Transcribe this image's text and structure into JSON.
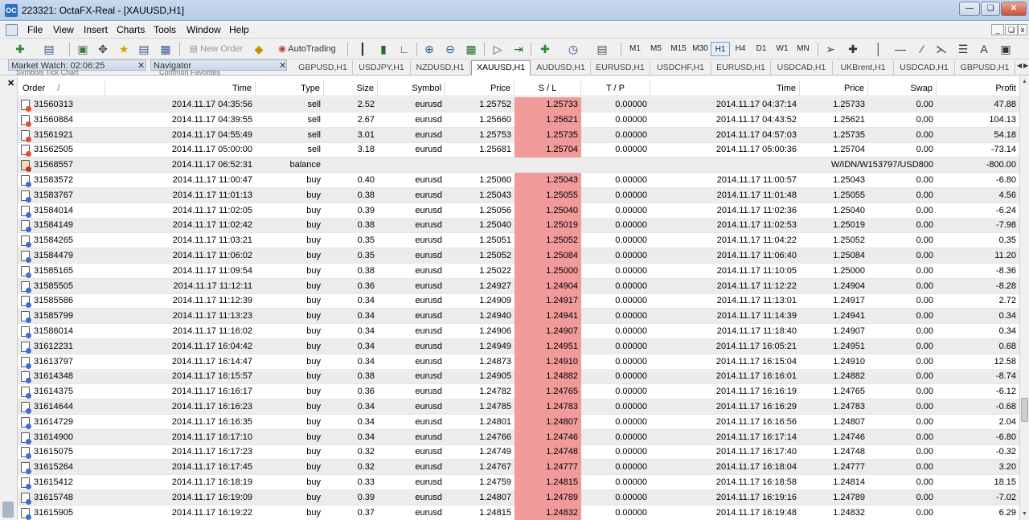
{
  "window": {
    "title": "223321: OctaFX-Real - [XAUUSD,H1]",
    "app_icon_text": "OC",
    "buttons": [
      "minimize",
      "restore",
      "close"
    ]
  },
  "menu": [
    "File",
    "View",
    "Insert",
    "Charts",
    "Tools",
    "Window",
    "Help"
  ],
  "toolbar": {
    "new_order_label": "New Order",
    "autotrading_label": "AutoTrading",
    "timeframes": [
      "M1",
      "M5",
      "M15",
      "M30",
      "H1",
      "H4",
      "D1",
      "W1",
      "MN"
    ],
    "active_timeframe": "H1",
    "draw_text_label": "A"
  },
  "market_watch": {
    "header": "Market Watch: 02:06:25",
    "tabs_ghost": "Symbols   Tick Chart"
  },
  "navigator": {
    "header": "Navigator",
    "tabs_ghost": "Common   Favorites"
  },
  "chart_tabs": [
    "GBPUSD,H1",
    "USDJPY,H1",
    "NZDUSD,H1",
    "XAUUSD,H1",
    "AUDUSD,H1",
    "EURUSD,H1",
    "USDCHF,H1",
    "EURUSD,H1",
    "USDCAD,H1",
    "UKBrent,H1",
    "USDCAD,H1",
    "GBPUSD,H1"
  ],
  "active_chart_tab": "XAUUSD,H1",
  "columns": {
    "order": "Order",
    "sort_marker": "/",
    "open_time": "Time",
    "type": "Type",
    "size": "Size",
    "symbol": "Symbol",
    "open_price": "Price",
    "sl": "S / L",
    "tp": "T / P",
    "close_time": "Time",
    "close_price": "Price",
    "swap": "Swap",
    "profit": "Profit"
  },
  "rows": [
    {
      "order": "31560313",
      "open_time": "2014.11.17 04:35:56",
      "type": "sell",
      "size": "2.52",
      "symbol": "eurusd",
      "open_price": "1.25752",
      "sl": "1.25733",
      "tp": "0.00000",
      "close_time": "2014.11.17 04:37:14",
      "close_price": "1.25733",
      "swap": "0.00",
      "profit": "47.88"
    },
    {
      "order": "31560884",
      "open_time": "2014.11.17 04:39:55",
      "type": "sell",
      "size": "2.67",
      "symbol": "eurusd",
      "open_price": "1.25660",
      "sl": "1.25621",
      "tp": "0.00000",
      "close_time": "2014.11.17 04:43:52",
      "close_price": "1.25621",
      "swap": "0.00",
      "profit": "104.13"
    },
    {
      "order": "31561921",
      "open_time": "2014.11.17 04:55:49",
      "type": "sell",
      "size": "3.01",
      "symbol": "eurusd",
      "open_price": "1.25753",
      "sl": "1.25735",
      "tp": "0.00000",
      "close_time": "2014.11.17 04:57:03",
      "close_price": "1.25735",
      "swap": "0.00",
      "profit": "54.18"
    },
    {
      "order": "31562505",
      "open_time": "2014.11.17 05:00:00",
      "type": "sell",
      "size": "3.18",
      "symbol": "eurusd",
      "open_price": "1.25681",
      "sl": "1.25704",
      "tp": "0.00000",
      "close_time": "2014.11.17 05:00:36",
      "close_price": "1.25704",
      "swap": "0.00",
      "profit": "-73.14"
    },
    {
      "order": "31568557",
      "open_time": "2014.11.17 06:52:31",
      "type": "balance",
      "size": "",
      "symbol": "",
      "open_price": "",
      "sl": "",
      "tp": "",
      "close_time": "",
      "close_price": "W/IDN/W153797/USD800",
      "swap": "",
      "profit": "-800.00"
    },
    {
      "order": "31583572",
      "open_time": "2014.11.17 11:00:47",
      "type": "buy",
      "size": "0.40",
      "symbol": "eurusd",
      "open_price": "1.25060",
      "sl": "1.25043",
      "tp": "0.00000",
      "close_time": "2014.11.17 11:00:57",
      "close_price": "1.25043",
      "swap": "0.00",
      "profit": "-6.80"
    },
    {
      "order": "31583767",
      "open_time": "2014.11.17 11:01:13",
      "type": "buy",
      "size": "0.38",
      "symbol": "eurusd",
      "open_price": "1.25043",
      "sl": "1.25055",
      "tp": "0.00000",
      "close_time": "2014.11.17 11:01:48",
      "close_price": "1.25055",
      "swap": "0.00",
      "profit": "4.56"
    },
    {
      "order": "31584014",
      "open_time": "2014.11.17 11:02:05",
      "type": "buy",
      "size": "0.39",
      "symbol": "eurusd",
      "open_price": "1.25056",
      "sl": "1.25040",
      "tp": "0.00000",
      "close_time": "2014.11.17 11:02:36",
      "close_price": "1.25040",
      "swap": "0.00",
      "profit": "-6.24"
    },
    {
      "order": "31584149",
      "open_time": "2014.11.17 11:02:42",
      "type": "buy",
      "size": "0.38",
      "symbol": "eurusd",
      "open_price": "1.25040",
      "sl": "1.25019",
      "tp": "0.00000",
      "close_time": "2014.11.17 11:02:53",
      "close_price": "1.25019",
      "swap": "0.00",
      "profit": "-7.98"
    },
    {
      "order": "31584265",
      "open_time": "2014.11.17 11:03:21",
      "type": "buy",
      "size": "0.35",
      "symbol": "eurusd",
      "open_price": "1.25051",
      "sl": "1.25052",
      "tp": "0.00000",
      "close_time": "2014.11.17 11:04:22",
      "close_price": "1.25052",
      "swap": "0.00",
      "profit": "0.35"
    },
    {
      "order": "31584479",
      "open_time": "2014.11.17 11:06:02",
      "type": "buy",
      "size": "0.35",
      "symbol": "eurusd",
      "open_price": "1.25052",
      "sl": "1.25084",
      "tp": "0.00000",
      "close_time": "2014.11.17 11:06:40",
      "close_price": "1.25084",
      "swap": "0.00",
      "profit": "11.20"
    },
    {
      "order": "31585165",
      "open_time": "2014.11.17 11:09:54",
      "type": "buy",
      "size": "0.38",
      "symbol": "eurusd",
      "open_price": "1.25022",
      "sl": "1.25000",
      "tp": "0.00000",
      "close_time": "2014.11.17 11:10:05",
      "close_price": "1.25000",
      "swap": "0.00",
      "profit": "-8.36"
    },
    {
      "order": "31585505",
      "open_time": "2014.11.17 11:12:11",
      "type": "buy",
      "size": "0.36",
      "symbol": "eurusd",
      "open_price": "1.24927",
      "sl": "1.24904",
      "tp": "0.00000",
      "close_time": "2014.11.17 11:12:22",
      "close_price": "1.24904",
      "swap": "0.00",
      "profit": "-8.28"
    },
    {
      "order": "31585586",
      "open_time": "2014.11.17 11:12:39",
      "type": "buy",
      "size": "0.34",
      "symbol": "eurusd",
      "open_price": "1.24909",
      "sl": "1.24917",
      "tp": "0.00000",
      "close_time": "2014.11.17 11:13:01",
      "close_price": "1.24917",
      "swap": "0.00",
      "profit": "2.72"
    },
    {
      "order": "31585799",
      "open_time": "2014.11.17 11:13:23",
      "type": "buy",
      "size": "0.34",
      "symbol": "eurusd",
      "open_price": "1.24940",
      "sl": "1.24941",
      "tp": "0.00000",
      "close_time": "2014.11.17 11:14:39",
      "close_price": "1.24941",
      "swap": "0.00",
      "profit": "0.34"
    },
    {
      "order": "31586014",
      "open_time": "2014.11.17 11:16:02",
      "type": "buy",
      "size": "0.34",
      "symbol": "eurusd",
      "open_price": "1.24906",
      "sl": "1.24907",
      "tp": "0.00000",
      "close_time": "2014.11.17 11:18:40",
      "close_price": "1.24907",
      "swap": "0.00",
      "profit": "0.34"
    },
    {
      "order": "31612231",
      "open_time": "2014.11.17 16:04:42",
      "type": "buy",
      "size": "0.34",
      "symbol": "eurusd",
      "open_price": "1.24949",
      "sl": "1.24951",
      "tp": "0.00000",
      "close_time": "2014.11.17 16:05:21",
      "close_price": "1.24951",
      "swap": "0.00",
      "profit": "0.68"
    },
    {
      "order": "31613797",
      "open_time": "2014.11.17 16:14:47",
      "type": "buy",
      "size": "0.34",
      "symbol": "eurusd",
      "open_price": "1.24873",
      "sl": "1.24910",
      "tp": "0.00000",
      "close_time": "2014.11.17 16:15:04",
      "close_price": "1.24910",
      "swap": "0.00",
      "profit": "12.58"
    },
    {
      "order": "31614348",
      "open_time": "2014.11.17 16:15:57",
      "type": "buy",
      "size": "0.38",
      "symbol": "eurusd",
      "open_price": "1.24905",
      "sl": "1.24882",
      "tp": "0.00000",
      "close_time": "2014.11.17 16:16:01",
      "close_price": "1.24882",
      "swap": "0.00",
      "profit": "-8.74"
    },
    {
      "order": "31614375",
      "open_time": "2014.11.17 16:16:17",
      "type": "buy",
      "size": "0.36",
      "symbol": "eurusd",
      "open_price": "1.24782",
      "sl": "1.24765",
      "tp": "0.00000",
      "close_time": "2014.11.17 16:16:19",
      "close_price": "1.24765",
      "swap": "0.00",
      "profit": "-6.12"
    },
    {
      "order": "31614644",
      "open_time": "2014.11.17 16:16:23",
      "type": "buy",
      "size": "0.34",
      "symbol": "eurusd",
      "open_price": "1.24785",
      "sl": "1.24783",
      "tp": "0.00000",
      "close_time": "2014.11.17 16:16:29",
      "close_price": "1.24783",
      "swap": "0.00",
      "profit": "-0.68"
    },
    {
      "order": "31614729",
      "open_time": "2014.11.17 16:16:35",
      "type": "buy",
      "size": "0.34",
      "symbol": "eurusd",
      "open_price": "1.24801",
      "sl": "1.24807",
      "tp": "0.00000",
      "close_time": "2014.11.17 16:16:56",
      "close_price": "1.24807",
      "swap": "0.00",
      "profit": "2.04"
    },
    {
      "order": "31614900",
      "open_time": "2014.11.17 16:17:10",
      "type": "buy",
      "size": "0.34",
      "symbol": "eurusd",
      "open_price": "1.24766",
      "sl": "1.24746",
      "tp": "0.00000",
      "close_time": "2014.11.17 16:17:14",
      "close_price": "1.24746",
      "swap": "0.00",
      "profit": "-6.80"
    },
    {
      "order": "31615075",
      "open_time": "2014.11.17 16:17:23",
      "type": "buy",
      "size": "0.32",
      "symbol": "eurusd",
      "open_price": "1.24749",
      "sl": "1.24748",
      "tp": "0.00000",
      "close_time": "2014.11.17 16:17:40",
      "close_price": "1.24748",
      "swap": "0.00",
      "profit": "-0.32"
    },
    {
      "order": "31615264",
      "open_time": "2014.11.17 16:17:45",
      "type": "buy",
      "size": "0.32",
      "symbol": "eurusd",
      "open_price": "1.24767",
      "sl": "1.24777",
      "tp": "0.00000",
      "close_time": "2014.11.17 16:18:04",
      "close_price": "1.24777",
      "swap": "0.00",
      "profit": "3.20"
    },
    {
      "order": "31615412",
      "open_time": "2014.11.17 16:18:19",
      "type": "buy",
      "size": "0.33",
      "symbol": "eurusd",
      "open_price": "1.24759",
      "sl": "1.24815",
      "tp": "0.00000",
      "close_time": "2014.11.17 16:18:58",
      "close_price": "1.24814",
      "swap": "0.00",
      "profit": "18.15"
    },
    {
      "order": "31615748",
      "open_time": "2014.11.17 16:19:09",
      "type": "buy",
      "size": "0.39",
      "symbol": "eurusd",
      "open_price": "1.24807",
      "sl": "1.24789",
      "tp": "0.00000",
      "close_time": "2014.11.17 16:19:16",
      "close_price": "1.24789",
      "swap": "0.00",
      "profit": "-7.02"
    },
    {
      "order": "31615905",
      "open_time": "2014.11.17 16:19:22",
      "type": "buy",
      "size": "0.37",
      "symbol": "eurusd",
      "open_price": "1.24815",
      "sl": "1.24832",
      "tp": "0.00000",
      "close_time": "2014.11.17 16:19:48",
      "close_price": "1.24832",
      "swap": "0.00",
      "profit": "6.29"
    }
  ],
  "colors": {
    "sl_highlight": "#f09a9a",
    "alt_row": "#ececec",
    "titlebar": "#b6cbe6"
  }
}
